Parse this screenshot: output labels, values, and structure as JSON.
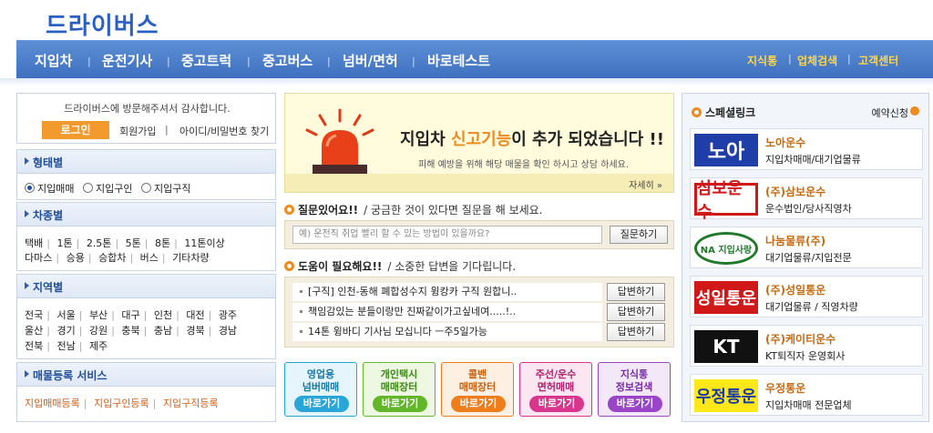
{
  "site": {
    "logo": "드라이버스"
  },
  "nav": {
    "items": [
      "지입차",
      "운전기사",
      "중고트럭",
      "중고버스",
      "넘버/면허",
      "바로테스트"
    ],
    "right": [
      "지식통",
      "업체검색",
      "고객센터"
    ]
  },
  "welcome": {
    "message": "드라이버스에 방문해주셔서 감사합니다.",
    "login": "로그인",
    "join": "회원가입",
    "find": "아이디/비밀번호 찾기"
  },
  "type_panel": {
    "title": "형태별",
    "options": [
      "지입매매",
      "지입구인",
      "지입구직"
    ],
    "selected": "지입매매"
  },
  "size_panel": {
    "title": "차종별",
    "row1": [
      "택배",
      "1톤",
      "2.5톤",
      "5톤",
      "8톤",
      "11톤이상"
    ],
    "row2": [
      "다마스",
      "승용",
      "승합차",
      "버스",
      "기타차량"
    ]
  },
  "region_panel": {
    "title": "지역별",
    "row1": [
      "전국",
      "서울",
      "부산",
      "대구",
      "인천",
      "대전",
      "광주"
    ],
    "row2": [
      "울산",
      "경기",
      "강원",
      "충북",
      "충남",
      "경북",
      "경남"
    ],
    "row3": [
      "전북",
      "전남",
      "제주"
    ]
  },
  "register_panel": {
    "title": "매물등록 서비스",
    "links": [
      "지입매매등록",
      "지입구인등록",
      "지입구직등록"
    ]
  },
  "banner": {
    "prefix": "지입차 ",
    "highlight": "신고기능",
    "suffix": "이 추가 되었습니다 !!",
    "sub": "피해 예방을 위해 해당 매물을 확인 하시고 상담 하세요.",
    "more": "자세히"
  },
  "question": {
    "title": "질문있어요!!",
    "desc": "/ 궁금한 것이 있다면 질문을 해 보세요.",
    "placeholder": "예) 운전직 취업 빨리 할 수 있는 방법이 있을까요?",
    "button": "질문하기"
  },
  "help": {
    "title": "도움이 필요해요!!",
    "desc": "/ 소중한 답변을 기다립니다.",
    "items": [
      "[구직] 인천-동해 폐합성수지 윙캉카 구직 원합니..",
      "책임감있는 분들이랑만 진짜같이가고싶네여.....!..",
      "14톤 윙바디 기사님 모십니다 ㅡ주5일가능"
    ],
    "button": "답변하기"
  },
  "tiles": [
    {
      "l1": "영업용",
      "l2": "넘버매매",
      "go": "바로가기",
      "color": "#2aa5d8",
      "bg": "#e6f4fb",
      "fg": "#1779a8"
    },
    {
      "l1": "개인택시",
      "l2": "매매장터",
      "go": "바로가기",
      "color": "#63b52a",
      "bg": "#edf7e2",
      "fg": "#3d8a14"
    },
    {
      "l1": "콜밴",
      "l2": "매매장터",
      "go": "바로가기",
      "color": "#ef7d1c",
      "bg": "#fdf0e2",
      "fg": "#c8600e"
    },
    {
      "l1": "주선/운수",
      "l2": "면허매매",
      "go": "바로가기",
      "color": "#d8368e",
      "bg": "#fbe6f1",
      "fg": "#b0206c"
    },
    {
      "l1": "지식통",
      "l2": "정보검색",
      "go": "바로가기",
      "color": "#9a45c8",
      "bg": "#f2e8f8",
      "fg": "#7a2aa8"
    }
  ],
  "special": {
    "title": "스페셜링크",
    "reserve": "예약신청",
    "cards": [
      {
        "logo": "노아",
        "name": "노아운수",
        "desc": "지입차매매/대기업물류",
        "logo_bg": "#1f3ea8",
        "logo_fg": "#ffffff"
      },
      {
        "logo": "삼보운수",
        "name": "(주)삼보운수",
        "desc": "운수법인/당사직영차",
        "logo_bg": "#ffffff",
        "logo_fg": "#d01818"
      },
      {
        "logo": "NA 지입사랑",
        "name": "나눔물류(주)",
        "desc": "대기업물류/지입전문",
        "logo_bg": "#ffffff",
        "logo_fg": "#1f7a2a"
      },
      {
        "logo": "성일통운",
        "name": "(주)성일통운",
        "desc": "대기업물류 / 직영차량",
        "logo_bg": "#d01818",
        "logo_fg": "#ffffff"
      },
      {
        "logo": "KT",
        "name": "(주)케이티운수",
        "desc": "KT퇴직자 운영회사",
        "logo_bg": "#111111",
        "logo_fg": "#ffffff"
      },
      {
        "logo": "우정통운",
        "name": "우정통운",
        "desc": "지입차매매 전문업체",
        "logo_bg": "#ffe81a",
        "logo_fg": "#1a3aa8"
      }
    ]
  }
}
